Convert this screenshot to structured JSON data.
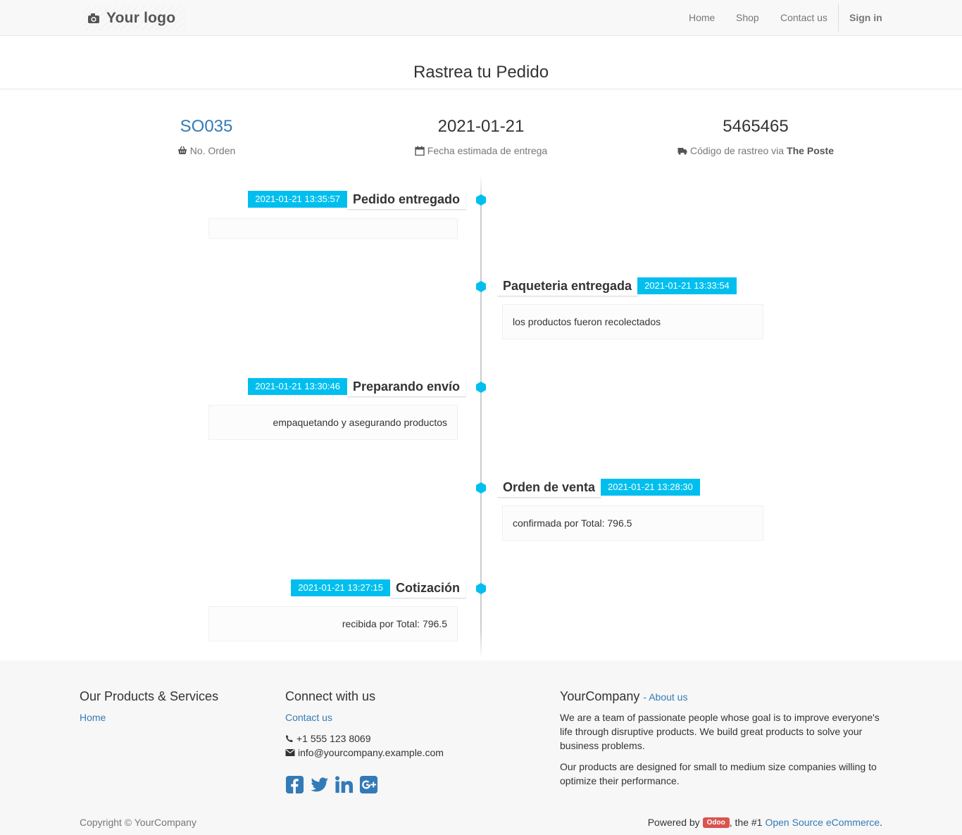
{
  "header": {
    "logo_text": "Your logo",
    "nav": [
      {
        "label": "Home"
      },
      {
        "label": "Shop"
      },
      {
        "label": "Contact us"
      }
    ],
    "signin_label": "Sign in"
  },
  "page": {
    "title": "Rastrea tu Pedido"
  },
  "summary": {
    "order_number": "SO035",
    "order_label": "No. Orden",
    "delivery_date": "2021-01-21",
    "delivery_label": "Fecha estimada de entrega",
    "tracking_code": "5465465",
    "tracking_label_prefix": "Código de rastreo via",
    "carrier": "The Poste"
  },
  "timeline": [
    {
      "timestamp": "2021-01-21 13:35:57",
      "title": "Pedido entregado",
      "description": "",
      "side": "left"
    },
    {
      "timestamp": "2021-01-21 13:33:54",
      "title": "Paqueteria entregada",
      "description": "los productos fueron recolectados",
      "side": "right"
    },
    {
      "timestamp": "2021-01-21 13:30:46",
      "title": "Preparando envío",
      "description": "empaquetando y asegurando productos",
      "side": "left"
    },
    {
      "timestamp": "2021-01-21 13:28:30",
      "title": "Orden de venta",
      "description": "confirmada por Total: 796.5",
      "side": "right"
    },
    {
      "timestamp": "2021-01-21 13:27:15",
      "title": "Cotización",
      "description": "recibida por Total: 796.5",
      "side": "left"
    }
  ],
  "colors": {
    "accent": "#00bfef",
    "link": "#337ab7",
    "odoo_badge": "#d9534f"
  },
  "footer": {
    "products_heading": "Our Products & Services",
    "products_links": [
      {
        "label": "Home"
      }
    ],
    "connect_heading": "Connect with us",
    "contact_link": "Contact us",
    "phone": "+1 555 123 8069",
    "email": "info@yourcompany.example.com",
    "social_icons": [
      "facebook-icon",
      "twitter-icon",
      "linkedin-icon",
      "google-plus-icon"
    ],
    "company_name": "YourCompany",
    "about_link": "- About us",
    "about_text_1": "We are a team of passionate people whose goal is to improve everyone's life through disruptive products. We build great products to solve your business problems.",
    "about_text_2": "Our products are designed for small to medium size companies willing to optimize their performance.",
    "copyright": "Copyright © YourCompany",
    "powered_prefix": "Powered by",
    "odoo_label": "Odoo",
    "powered_middle": ", the #1",
    "powered_link": "Open Source eCommerce",
    "powered_suffix": "."
  }
}
